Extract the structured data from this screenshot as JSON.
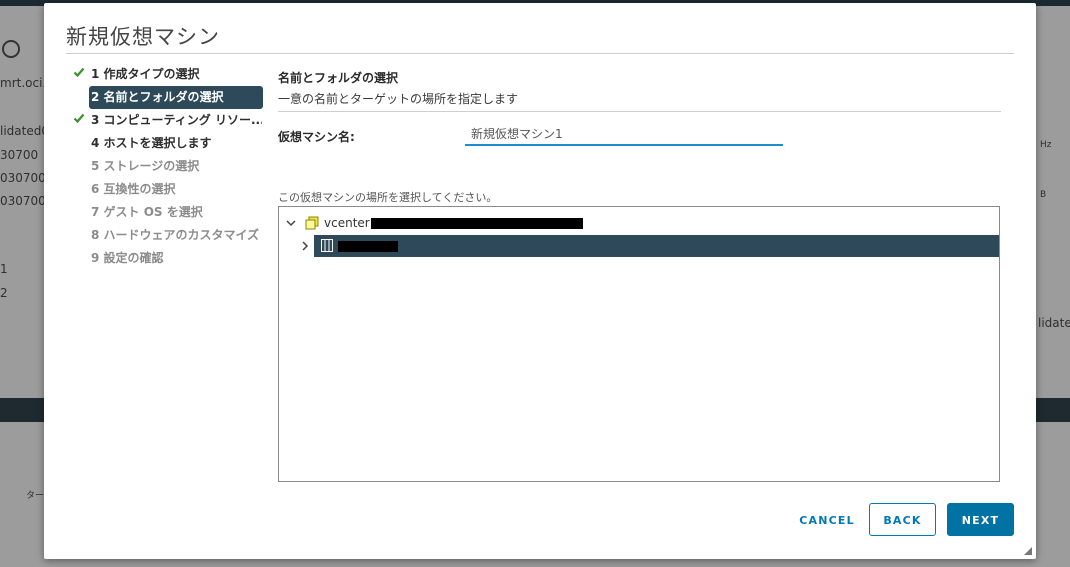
{
  "background": {
    "host_text": "mrt.oci.c",
    "items": [
      "lidated0",
      "30700",
      "030700",
      "030700"
    ],
    "num1": "1",
    "num2": "2",
    "right_text1": "Hz",
    "right_text2": "B",
    "right_text3": "lidate",
    "bottom_text": "ター"
  },
  "dialog": {
    "title": "新規仮想マシン",
    "steps": [
      {
        "label": "1 作成タイプの選択",
        "state": "done"
      },
      {
        "label": "2 名前とフォルダの選択",
        "state": "active"
      },
      {
        "label": "3 コンピューティング リソー...",
        "state": "done"
      },
      {
        "label": "4 ホストを選択します",
        "state": "pending"
      },
      {
        "label": "5 ストレージの選択",
        "state": "disabled"
      },
      {
        "label": "6 互換性の選択",
        "state": "disabled"
      },
      {
        "label": "7 ゲスト OS を選択",
        "state": "disabled"
      },
      {
        "label": "8 ハードウェアのカスタマイズ",
        "state": "disabled"
      },
      {
        "label": "9 設定の確認",
        "state": "disabled"
      }
    ],
    "section_title": "名前とフォルダの選択",
    "section_subtitle": "一意の名前とターゲットの場所を指定します",
    "vm_name_label": "仮想マシン名:",
    "vm_name_value": "新規仮想マシン1",
    "location_label": "この仮想マシンの場所を選択してください。",
    "tree": {
      "root_label": "vcenter",
      "root_icon": "vcenter-icon",
      "child_icon": "datacenter-icon"
    },
    "buttons": {
      "cancel": "CANCEL",
      "back": "BACK",
      "next": "NEXT"
    }
  },
  "colors": {
    "accent": "#0079b8",
    "selected": "#2e4a5a",
    "check": "#3c8f2f"
  }
}
